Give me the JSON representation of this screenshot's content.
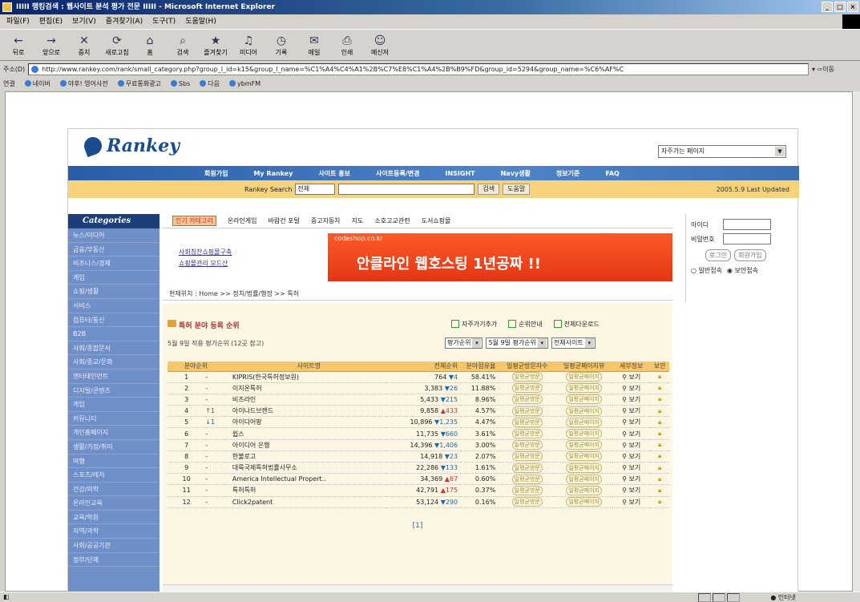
{
  "window": {
    "title": "IIIII 랭킹검색 : 웹사이트 분석 평가 전문 IIIII - Microsoft Internet Explorer",
    "controls": [
      "_",
      "□",
      "×"
    ]
  },
  "menubar": [
    "파일(F)",
    "편집(E)",
    "보기(V)",
    "즐겨찾기(A)",
    "도구(T)",
    "도움말(H)"
  ],
  "toolbar": [
    {
      "label": "뒤로",
      "icon": "back-arrow-icon",
      "glyph": "←"
    },
    {
      "label": "앞으로",
      "icon": "forward-arrow-icon",
      "glyph": "→"
    },
    {
      "label": "중지",
      "icon": "stop-icon",
      "glyph": "✕"
    },
    {
      "label": "새로고침",
      "icon": "refresh-icon",
      "glyph": "⟳"
    },
    {
      "label": "홈",
      "icon": "home-icon",
      "glyph": "⌂"
    },
    {
      "label": "검색",
      "icon": "search-icon",
      "glyph": "⌕"
    },
    {
      "label": "즐겨찾기",
      "icon": "favorites-icon",
      "glyph": "★"
    },
    {
      "label": "미디어",
      "icon": "media-icon",
      "glyph": "♫"
    },
    {
      "label": "기록",
      "icon": "history-icon",
      "glyph": "◷"
    },
    {
      "label": "메일",
      "icon": "mail-icon",
      "glyph": "✉"
    },
    {
      "label": "인쇄",
      "icon": "print-icon",
      "glyph": "⎙"
    },
    {
      "label": "메신저",
      "icon": "messenger-icon",
      "glyph": "☺"
    }
  ],
  "address": {
    "label": "주소(D)",
    "url": "http://www.rankey.com/rank/small_category.php?group_l_id=k15&group_l_name=%C1%A4%C4%A1%2B%C7%E8%C1%A4%2B%B9%FD&group_id=5294&group_name=%C6%AF%C"
  },
  "links": {
    "label": "연결",
    "items": [
      "네이버",
      "야후! 영어사전",
      "무료통화광고",
      "Sbs",
      "다음",
      "ybmFM"
    ]
  },
  "site": {
    "brand": "Rankey",
    "top_select": "자주가는 페이지",
    "nav": [
      "회원가입",
      "My Rankey",
      "사이트 홍보",
      "사이트등록/변경",
      "INSIGHT",
      "Navy생활",
      "정보기준",
      "FAQ"
    ],
    "search": {
      "label": "Rankey Search",
      "scope": "전체",
      "go": "검색",
      "help": "도움말",
      "updated": "2005.5.9 Last Updated"
    },
    "categories_title": "Categories",
    "categories": [
      "뉴스/미디어",
      "금융/부동산",
      "비즈니스/경제",
      "게임",
      "쇼핑/생활",
      "서비스",
      "컴퓨터/통신",
      "B2B",
      "사회/종합문서",
      "사회/종교/문화",
      "엔터테인먼트",
      "디지털/콘텐츠",
      "게임",
      "커뮤니티",
      "개인홈페이지",
      "생활/가정/취미",
      "여행",
      "스포츠/레저",
      "건강/의학",
      "온라인교육",
      "교육/학원",
      "지역/과학",
      "사회/공공기관",
      "정부/단체"
    ],
    "cat_tabs": [
      "인기 카테고리",
      "온라인게임",
      "바람건 포털",
      "중고자동차",
      "지도",
      "소호고교관련",
      "도서쇼핑몰"
    ],
    "login": {
      "id_label": "아이디",
      "pw_label": "비밀번호",
      "login_btn": "로그인",
      "join_btn": "회원가입",
      "opt1": "일반접속",
      "opt2": "보안접속"
    },
    "banner": {
      "left_lines": [
        "사회칭찬쇼핑몰구축",
        "쇼핑몰관리 모드산"
      ],
      "ad_domain": "codeshop.co.kr",
      "ad_text": "안클라인 웹호스팅 1년공짜 !!"
    },
    "breadcrumb": "현재위치 : Home >> 정치/법률/행정 >> 특허",
    "section_title": "특허 분야 등록 순위",
    "section_sub": "5월 9일 적용 평가순위 (12곳 참고)",
    "actions": [
      "자주가기추가",
      "순위안내",
      "전체다운로드"
    ],
    "filters": [
      "평가순위",
      "5월 9일 평가순위",
      "전체사이트"
    ],
    "table": {
      "headers": [
        "분야순위",
        "사이트명",
        "전체순위",
        "분야점유율",
        "일평균방문자수",
        "일평균페이지뷰",
        "세부정보",
        "보안"
      ],
      "rows": [
        {
          "rank": "1",
          "trend": "-",
          "site": "KIPRIS(한국특허정보원)",
          "total": "764",
          "chg": "▼4",
          "dir": "dn",
          "share": "58.41%",
          "view": "보기"
        },
        {
          "rank": "2",
          "trend": "-",
          "site": "이지온특허",
          "total": "3,383",
          "chg": "▼26",
          "dir": "dn",
          "share": "11.88%",
          "view": "보기"
        },
        {
          "rank": "3",
          "trend": "-",
          "site": "비즈라인",
          "total": "5,433",
          "chg": "▼215",
          "dir": "dn",
          "share": "8.96%",
          "view": "보기"
        },
        {
          "rank": "4",
          "trend": "↑1",
          "site": "아이나드브랜드",
          "total": "9,858",
          "chg": "▲433",
          "dir": "up",
          "share": "4.57%",
          "view": "보기"
        },
        {
          "rank": "5",
          "trend": "↓1",
          "site": "아이디어팡",
          "total": "10,896",
          "chg": "▼1,235",
          "dir": "dn",
          "share": "4.47%",
          "view": "보기"
        },
        {
          "rank": "6",
          "trend": "-",
          "site": "윕스",
          "total": "11,735",
          "chg": "▼660",
          "dir": "dn",
          "share": "3.61%",
          "view": "보기"
        },
        {
          "rank": "7",
          "trend": "-",
          "site": "아이디어 은행",
          "total": "14,396",
          "chg": "▼1,406",
          "dir": "dn",
          "share": "3.00%",
          "view": "보기"
        },
        {
          "rank": "8",
          "trend": "-",
          "site": "한불로고",
          "total": "14,918",
          "chg": "▼23",
          "dir": "dn",
          "share": "2.07%",
          "view": "보기"
        },
        {
          "rank": "9",
          "trend": "-",
          "site": "대륙국제특허법률사무소",
          "total": "22,286",
          "chg": "▼133",
          "dir": "dn",
          "share": "1.61%",
          "view": "보기"
        },
        {
          "rank": "10",
          "trend": "-",
          "site": "America Intellectual Propert..",
          "total": "34,369",
          "chg": "▲67",
          "dir": "up",
          "share": "0.60%",
          "view": "보기"
        },
        {
          "rank": "11",
          "trend": "-",
          "site": "특허특허",
          "total": "42,791",
          "chg": "▲175",
          "dir": "up",
          "share": "0.37%",
          "view": "보기"
        },
        {
          "rank": "12",
          "trend": "-",
          "site": "Click2patent",
          "total": "53,124",
          "chg": "▼290",
          "dir": "dn",
          "share": "0.16%",
          "view": "보기"
        }
      ],
      "badge1": "일평균방문",
      "badge2": "일평균페이지"
    },
    "pager": "[1]"
  },
  "status": {
    "zone": "인터넷"
  }
}
